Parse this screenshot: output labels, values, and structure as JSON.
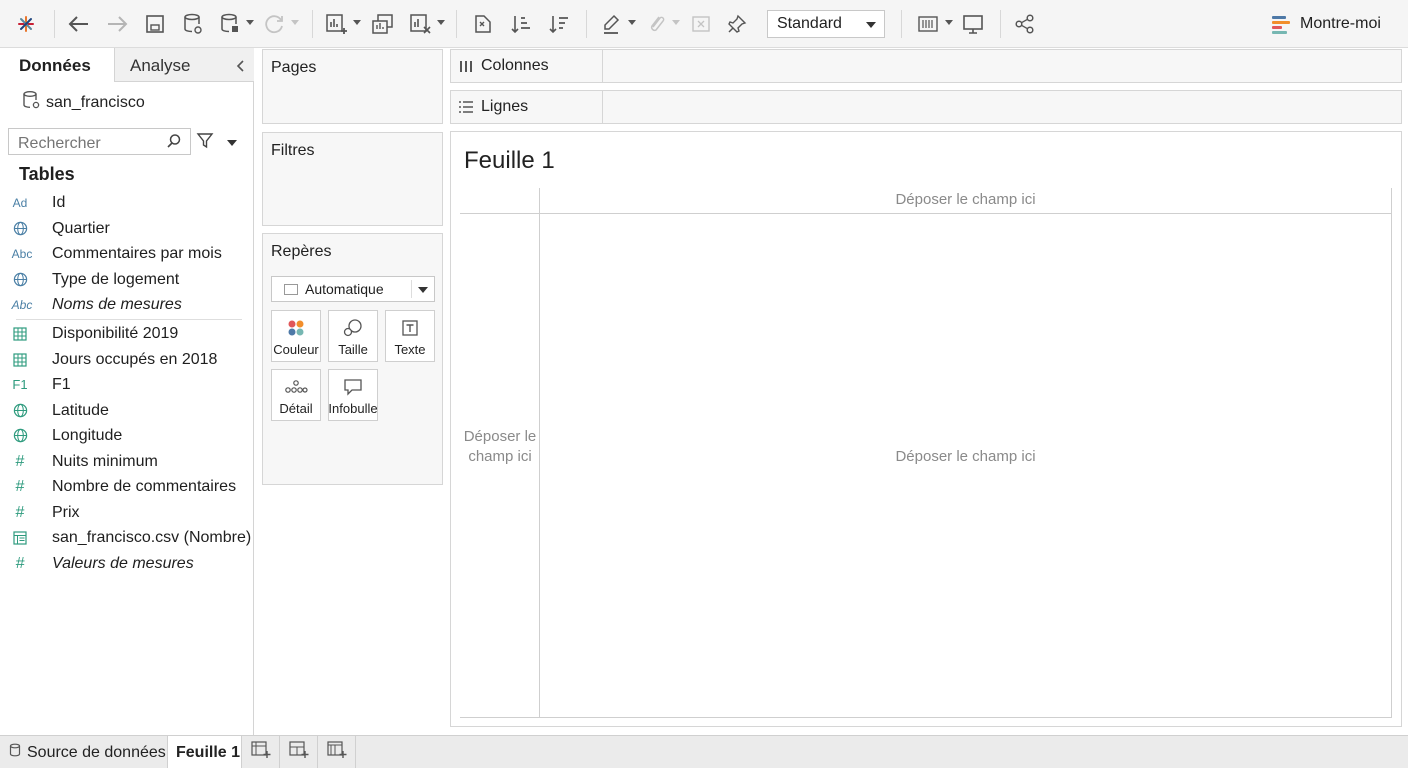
{
  "toolbar": {
    "standard_select": "Standard",
    "show_me_label": "Montre-moi"
  },
  "data_pane": {
    "tabs": [
      {
        "label": "Données",
        "active": true
      },
      {
        "label": "Analyse",
        "active": false
      }
    ],
    "datasource": "san_francisco",
    "search_placeholder": "Rechercher",
    "tables_title": "Tables",
    "dimensions": [
      {
        "icon": "Ad",
        "label": "Id",
        "italic": false
      },
      {
        "icon": "globe-icon",
        "label": "Quartier",
        "italic": false
      },
      {
        "icon": "Abc",
        "label": "Commentaires par mois",
        "italic": false
      },
      {
        "icon": "globe-icon",
        "label": "Type de logement",
        "italic": false
      },
      {
        "icon": "Abc",
        "label": "Noms de mesures",
        "italic": true
      }
    ],
    "measures": [
      {
        "icon": "grid-icon",
        "label": "Disponibilité 2019",
        "italic": false
      },
      {
        "icon": "grid-icon",
        "label": "Jours occupés en 2018",
        "italic": false
      },
      {
        "icon": "F1",
        "label": "F1",
        "italic": false
      },
      {
        "icon": "globe-icon",
        "label": "Latitude",
        "italic": false
      },
      {
        "icon": "globe-icon",
        "label": "Longitude",
        "italic": false
      },
      {
        "icon": "#",
        "label": "Nuits minimum",
        "italic": false
      },
      {
        "icon": "#",
        "label": "Nombre de commentaires",
        "italic": false
      },
      {
        "icon": "#",
        "label": "Prix",
        "italic": false
      },
      {
        "icon": "table-icon",
        "label": "san_francisco.csv (Nombre)",
        "italic": false
      },
      {
        "icon": "#",
        "label": "Valeurs de mesures",
        "italic": true
      }
    ]
  },
  "cards": {
    "pages": "Pages",
    "filters": "Filtres",
    "marks": "Repères",
    "mark_type": "Automatique",
    "mark_buttons": [
      "Couleur",
      "Taille",
      "Texte",
      "Détail",
      "Infobulle"
    ]
  },
  "shelves": {
    "columns": "Colonnes",
    "rows": "Lignes"
  },
  "view": {
    "sheet_title": "Feuille 1",
    "drop_top": "Déposer le champ ici",
    "drop_left": "Déposer le champ ici",
    "drop_center": "Déposer le champ ici"
  },
  "bottom_tabs": {
    "data_source": "Source de données",
    "sheet": "Feuille 1"
  }
}
